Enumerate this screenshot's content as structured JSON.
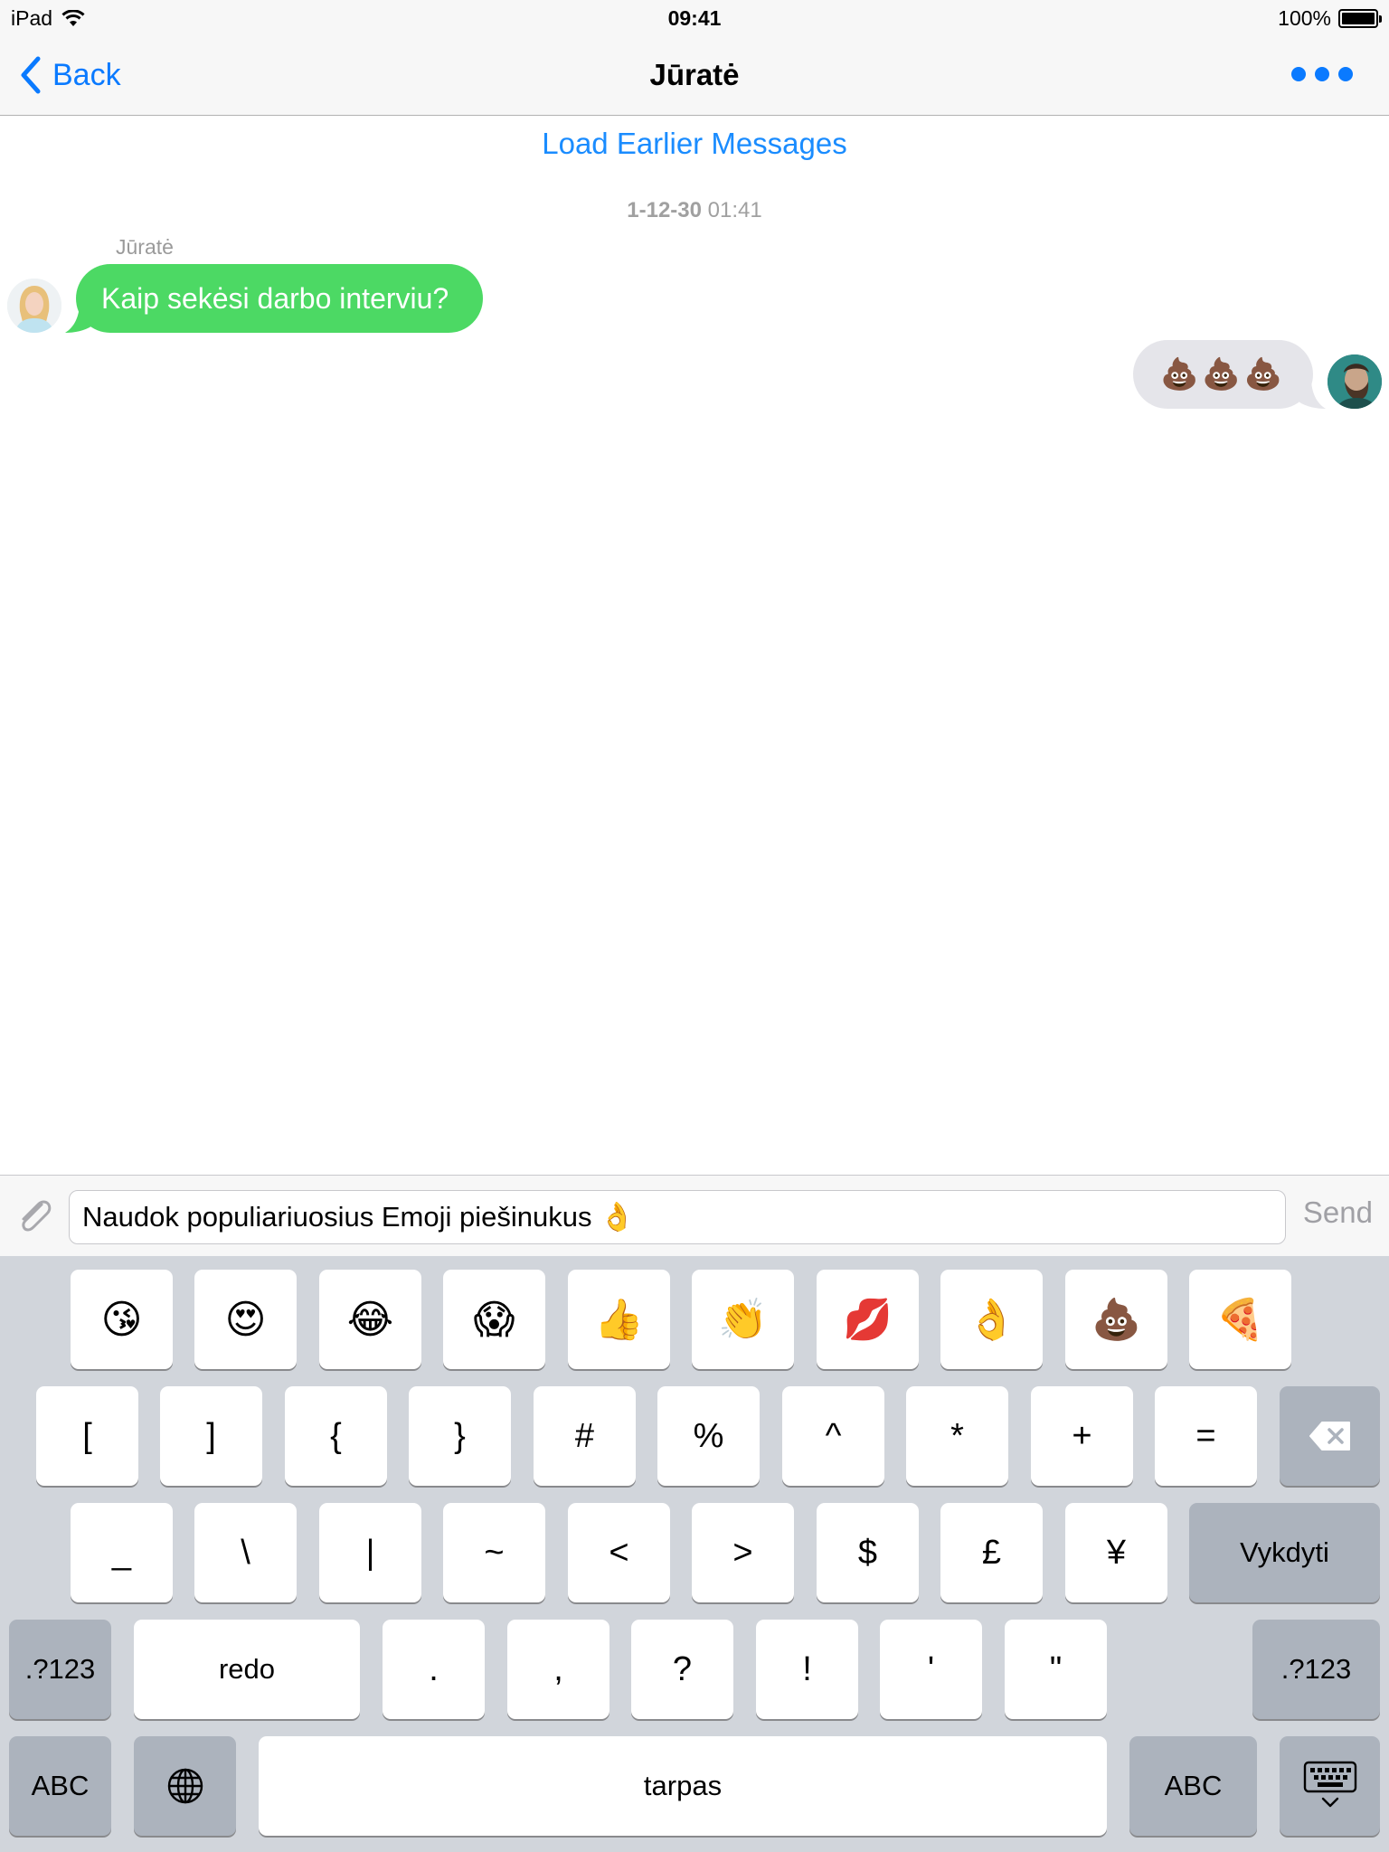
{
  "status_bar": {
    "device": "iPad",
    "time": "09:41",
    "battery": "100%"
  },
  "nav": {
    "back_label": "Back",
    "title": "Jūratė"
  },
  "chat": {
    "load_earlier": "Load Earlier Messages",
    "timestamp_date": "1-12-30",
    "timestamp_time": "01:41",
    "sender_name": "Jūratė",
    "incoming_text": "Kaip sekėsi darbo interviu?",
    "outgoing_text": "💩💩💩"
  },
  "input": {
    "text": "Naudok populiariuosius Emoji piešinukus 👌",
    "send_label": "Send"
  },
  "keyboard": {
    "emoji_row": [
      "😘",
      "😍",
      "😂",
      "😱",
      "👍",
      "👏",
      "💋",
      "👌",
      "💩",
      "🍕"
    ],
    "row1": [
      "[",
      "]",
      "{",
      "}",
      "#",
      "%",
      "^",
      "*",
      "+",
      "="
    ],
    "row2": [
      "_",
      "\\",
      "|",
      "~",
      "<",
      ">",
      "$",
      "£",
      "¥"
    ],
    "return_label": "Vykdyti",
    "row3_left": ".?123",
    "redo_label": "redo",
    "row3": [
      ".",
      ",",
      "?",
      "!",
      "'",
      "\""
    ],
    "row3_right": ".?123",
    "abc_left": "ABC",
    "space_label": "tarpas",
    "abc_right": "ABC"
  },
  "colors": {
    "accent": "#0a7aff",
    "incoming_bubble": "#4cd964",
    "outgoing_bubble": "#e5e5ea",
    "keyboard_bg": "#d1d5db"
  },
  "icons": [
    "wifi-icon",
    "battery-icon",
    "back-chevron-icon",
    "more-dots-icon",
    "paperclip-icon",
    "backspace-icon",
    "globe-icon",
    "keyboard-dismiss-icon"
  ]
}
